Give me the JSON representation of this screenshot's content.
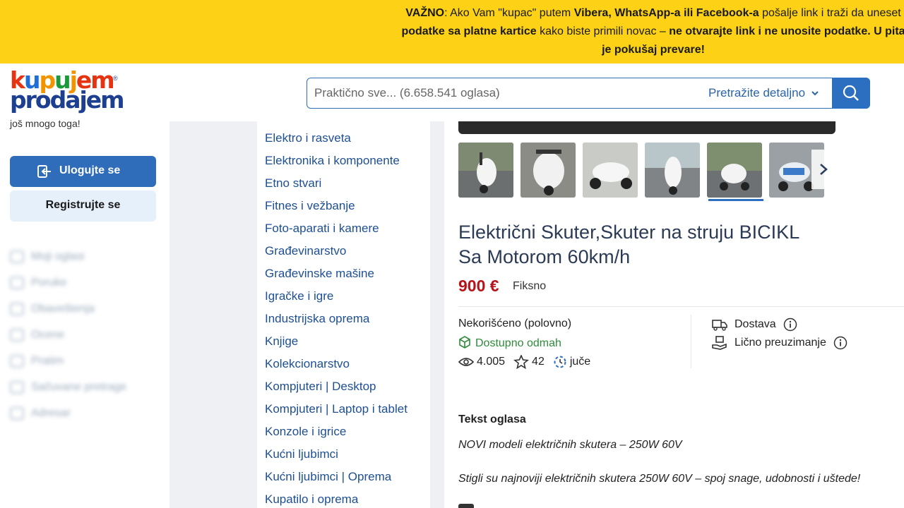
{
  "banner": {
    "p1": "VAŽNO",
    "p2": ": Ako Vam \"kupac\" putem ",
    "p3": "Vibera, WhatsApp-a ili Facebook-a",
    "p4": " pošalje link i traži da uneset",
    "p5": "podatke sa platne kartice",
    "p6": " kako biste primili novac – ",
    "p7": "ne otvarajte link i ne unosite podatke. U pita",
    "p8": "je pokušaj prevare!"
  },
  "logo": {
    "line1_a": "k",
    "line1_b": "u",
    "line1_c": "p",
    "line1_d": "u",
    "line1_e": "j",
    "line1_f": "em",
    "line2": "prodajem",
    "reg": "®"
  },
  "search": {
    "placeholder": "Praktično sve... (6.658.541 oglasa)",
    "detail_label": "Pretražite detaljno"
  },
  "sidebar": {
    "note": "još mnogo toga!",
    "login_label": "Ulogujte se",
    "register_label": "Registrujte se",
    "menu": [
      "Moji oglasi",
      "Poruke",
      "Obaveštenja",
      "Ocene",
      "Pratim",
      "Sačuvane pretrage",
      "Adresar"
    ]
  },
  "categories": [
    "Elektro i rasveta",
    "Elektronika i komponente",
    "Etno stvari",
    "Fitnes i vežbanje",
    "Foto-aparati i kamere",
    "Građevinarstvo",
    "Građevinske mašine",
    "Igračke i igre",
    "Industrijska oprema",
    "Knjige",
    "Kolekcionarstvo",
    "Kompjuteri | Desktop",
    "Kompjuteri | Laptop i tablet",
    "Konzole i igrice",
    "Kućni ljubimci",
    "Kućni ljubimci | Oprema",
    "Kupatilo i oprema"
  ],
  "ad": {
    "title_line1": "Električni Skuter,Skuter na struju BICIKL",
    "title_line2": "Sa Motorom 60km/h",
    "price": "900 €",
    "price_type": "Fiksno",
    "condition": "Nekorišćeno (polovno)",
    "availability": "Dostupno odmah",
    "views": "4.005",
    "favorites": "42",
    "posted": "juče",
    "delivery": "Dostava",
    "pickup": "Lično preuzimanje",
    "section_title": "Tekst oglasa",
    "desc1": "NOVI modeli električnih skutera – 250W 60V",
    "desc2": "Stigli su najnoviji električnih skutera 250W 60V – spoj snage, udobnosti i uštede!"
  },
  "colors": {
    "banner": "#fcd116",
    "accent": "#2c6fc0",
    "price": "#b8131a",
    "available": "#2e8b3a",
    "link": "#1d4f91"
  },
  "icons": {
    "search": "search-icon",
    "login": "login-icon",
    "chevron": "chevron-down-icon",
    "next": "chevron-right-icon",
    "eye": "eye-icon",
    "star": "star-icon",
    "clock": "clock-icon",
    "box": "box-icon",
    "truck": "truck-icon",
    "hand": "hand-package-icon",
    "info": "info-icon"
  }
}
